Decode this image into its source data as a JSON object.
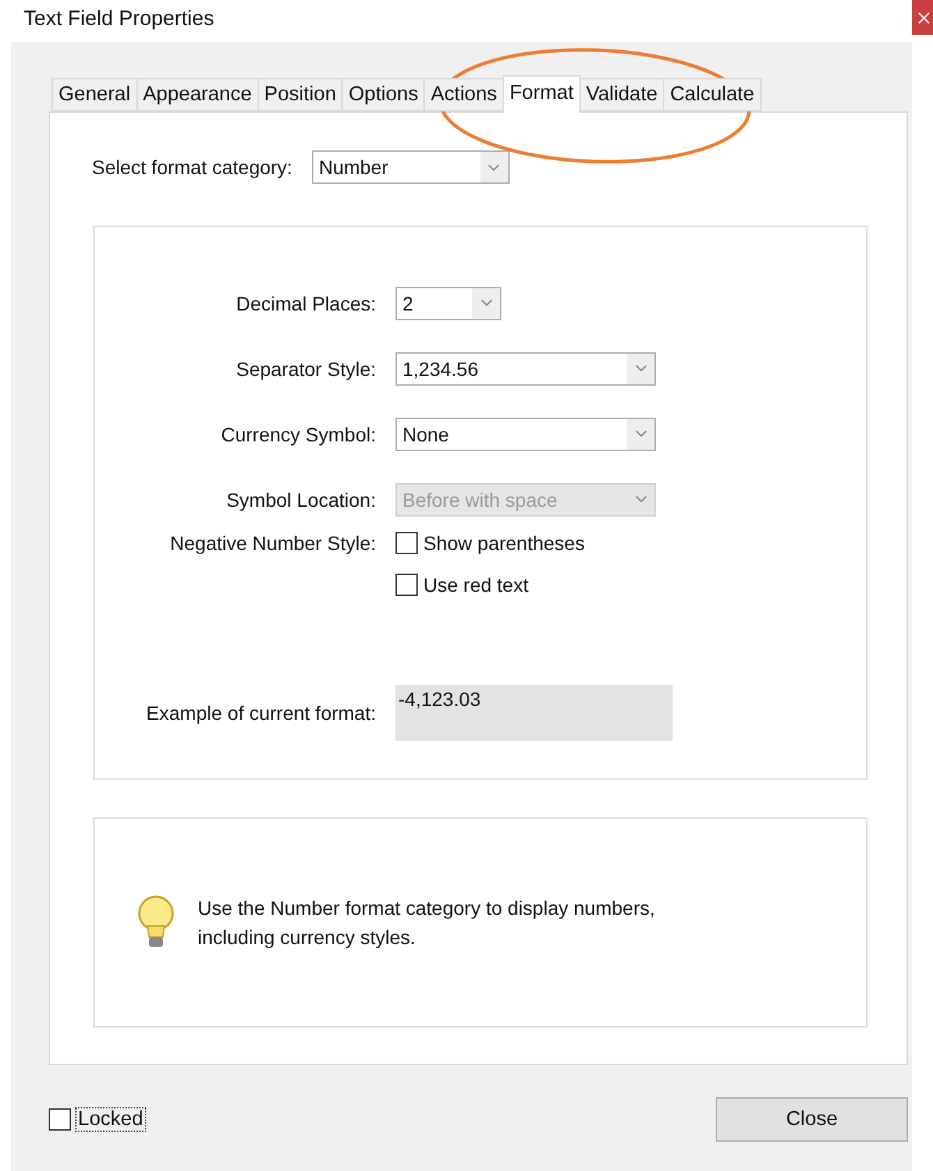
{
  "window": {
    "title": "Text Field Properties"
  },
  "tabs": [
    {
      "label": "General",
      "selected": false
    },
    {
      "label": "Appearance",
      "selected": false
    },
    {
      "label": "Position",
      "selected": false
    },
    {
      "label": "Options",
      "selected": false
    },
    {
      "label": "Actions",
      "selected": false
    },
    {
      "label": "Format",
      "selected": true
    },
    {
      "label": "Validate",
      "selected": false
    },
    {
      "label": "Calculate",
      "selected": false
    }
  ],
  "format_category": {
    "label": "Select format category:",
    "value": "Number"
  },
  "fields": [
    {
      "kind": "short_select",
      "label": "Decimal Places:",
      "value": "2",
      "disabled": false
    },
    {
      "kind": "select",
      "label": "Separator Style:",
      "value": "1,234.56",
      "disabled": false
    },
    {
      "kind": "select",
      "label": "Currency Symbol:",
      "value": "None",
      "disabled": false
    },
    {
      "kind": "select",
      "label": "Symbol Location:",
      "value": "Before with space",
      "disabled": true
    },
    {
      "kind": "checkboxes",
      "label": "Negative Number Style:",
      "options": [
        {
          "label": "Show parentheses",
          "checked": false
        },
        {
          "label": "Use red text",
          "checked": false
        }
      ]
    }
  ],
  "example": {
    "label": "Example of current format:",
    "value": "-4,123.03"
  },
  "hint": {
    "text": "Use the Number format category to display numbers, including currency styles."
  },
  "locked": {
    "label": "Locked",
    "checked": false
  },
  "buttons": [
    {
      "label": "Close"
    }
  ]
}
